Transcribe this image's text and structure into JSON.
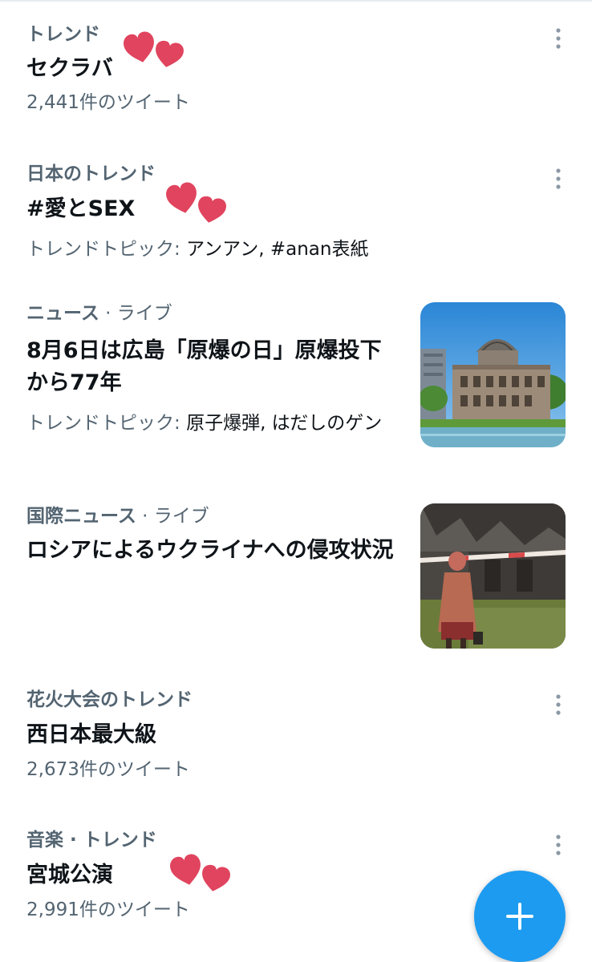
{
  "trends": [
    {
      "category": "トレンド",
      "title": "セクラバ",
      "subtitle": "2,441件のツイート"
    },
    {
      "category": "日本のトレンド",
      "title": "#愛とSEX",
      "subtitle_label": "トレンドトピック: ",
      "subtitle_value": "アンアン, #anan表紙"
    },
    {
      "category": "ニュース",
      "category_suffix": " · ライブ",
      "title": "8月6日は広島「原爆の日」原爆投下から77年",
      "subtitle_label": "トレンドトピック: ",
      "subtitle_value": "原子爆弾, はだしのゲン",
      "thumbnail": "atomic-bomb-dome-photo"
    },
    {
      "category": "国際ニュース",
      "category_suffix": " · ライブ",
      "title": "ロシアによるウクライナへの侵攻状況",
      "thumbnail": "woman-ruins-photo"
    },
    {
      "category": "花火大会のトレンド",
      "title": "西日本最大級",
      "subtitle": "2,673件のツイート"
    },
    {
      "category": "音楽 · トレンド",
      "title": "宮城公演",
      "subtitle": "2,991件のツイート"
    }
  ],
  "icons": {
    "more": "more-vertical-icon",
    "compose": "plus-icon",
    "decoration": "hearts-sticker"
  },
  "colors": {
    "accent": "#1d9bf0",
    "secondary_text": "#536471",
    "primary_text": "#0f1419",
    "heart": "#e0445e"
  }
}
